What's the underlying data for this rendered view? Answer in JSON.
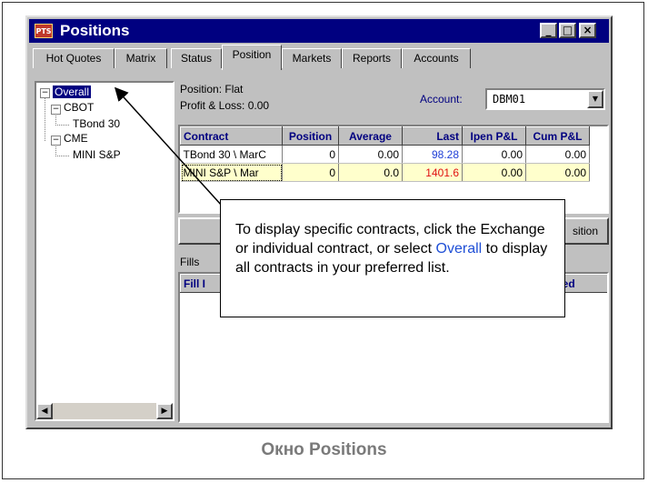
{
  "window": {
    "icon_text": "PTS",
    "title": "Positions",
    "minimize_symbol": "_",
    "maximize_symbol": "□",
    "close_symbol": "×"
  },
  "tabs": [
    {
      "label": "Hot Quotes",
      "active": false
    },
    {
      "label": "Matrix",
      "active": false
    },
    {
      "label": "Status",
      "active": false
    },
    {
      "label": "Position",
      "active": true
    },
    {
      "label": "Markets",
      "active": false
    },
    {
      "label": "Reports",
      "active": false
    },
    {
      "label": "Accounts",
      "active": false
    }
  ],
  "tree": {
    "root": "Overall",
    "exchanges": [
      {
        "name": "CBOT",
        "contracts": [
          "TBond 30"
        ]
      },
      {
        "name": "CME",
        "contracts": [
          "MINI S&P"
        ]
      }
    ],
    "expander": "−"
  },
  "position_info": {
    "position_text": "Position: Flat",
    "pnl_text": "Profit & Loss: 0.00",
    "account_label": "Account:",
    "account_value": "DBM01"
  },
  "grid": {
    "columns": [
      "Contract",
      "Position",
      "Average",
      "Last",
      "Ipen P&L",
      "Cum P&L"
    ],
    "rows": [
      {
        "contract": "TBond 30 \\ MarC",
        "position": "0",
        "average": "0.00",
        "last": "98.28",
        "open_pnl": "0.00",
        "cum_pnl": "0.00",
        "last_color": "#1f3fd6",
        "selected": false
      },
      {
        "contract": "MINI S&P \\ Mar",
        "position": "0",
        "average": "0.0",
        "last": "1401.6",
        "open_pnl": "0.00",
        "cum_pnl": "0.00",
        "last_color": "#e01010",
        "selected": true
      }
    ],
    "selected_row_color": "#ffffcc"
  },
  "close_position_button": "sition",
  "fills": {
    "label": "Fills",
    "columns": [
      "Fill I",
      "ved"
    ]
  },
  "callout": {
    "text_before": "To display specific contracts, click the Exchange or individual contract, or select ",
    "link_word": "Overall",
    "text_after": " to display all contracts in your preferred list."
  },
  "caption": "Окно Positions"
}
